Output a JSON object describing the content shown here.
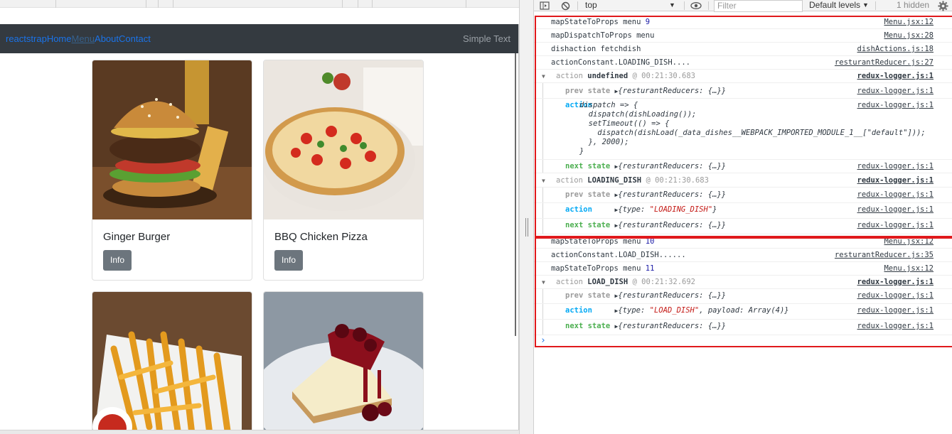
{
  "app": {
    "brand": "reactstrap",
    "nav_links": [
      "Home",
      "Menu",
      "About",
      "Contact"
    ],
    "active_link": "Menu",
    "nav_right_text": "Simple Text",
    "cards": [
      {
        "title": "Ginger Burger",
        "button": "Info",
        "image": "burger"
      },
      {
        "title": "BBQ Chicken Pizza",
        "button": "Info",
        "image": "pizza"
      },
      {
        "title": "",
        "button": "",
        "image": "fries"
      },
      {
        "title": "",
        "button": "",
        "image": "cheesecake"
      }
    ]
  },
  "devtools": {
    "toolbar": {
      "context": "top",
      "filter_placeholder": "Filter",
      "levels": "Default levels",
      "hidden": "1 hidden",
      "icons": [
        "sidebar-toggle-icon",
        "clear-console-icon",
        "eye-icon",
        "gear-icon"
      ]
    },
    "log": {
      "r1": {
        "text": "mapStateToProps menu ",
        "num": "9",
        "src": "Menu.jsx:12"
      },
      "r2": {
        "text": "mapDispatchToProps menu",
        "src": "Menu.jsx:28"
      },
      "r3": {
        "text": "dishaction fetchdish",
        "src": "dishActions.js:18"
      },
      "r4": {
        "text": "actionConstant.LOADING_DISH....",
        "src": "resturantReducer.js:27"
      },
      "g1": {
        "label": "action",
        "type": "undefined",
        "time": "@ 00:21:30.683",
        "src": "redux-logger.js:1"
      },
      "g1_prev": {
        "key": "prev state",
        "val": "{resturantReducers: {…}}",
        "src": "redux-logger.js:1"
      },
      "g1_action": {
        "key": "action",
        "code": "dispatch => {\n  dispatch(dishLoading());\n  setTimeout(() => {\n    dispatch(dishLoad(_data_dishes__WEBPACK_IMPORTED_MODULE_1__[\"default\"]));\n  }, 2000);\n}",
        "src": "redux-logger.js:1"
      },
      "g1_next": {
        "key": "next state",
        "val": "{resturantReducers: {…}}",
        "src": "redux-logger.js:1"
      },
      "g2": {
        "label": "action",
        "type": "LOADING_DISH",
        "time": "@ 00:21:30.683",
        "src": "redux-logger.js:1"
      },
      "g2_prev": {
        "key": "prev state",
        "val": "{resturantReducers: {…}}",
        "src": "redux-logger.js:1"
      },
      "g2_action": {
        "key": "action",
        "pre": "{type: ",
        "str": "\"LOADING_DISH\"",
        "post": "}",
        "src": "redux-logger.js:1"
      },
      "g2_next": {
        "key": "next state",
        "val": "{resturantReducers: {…}}",
        "src": "redux-logger.js:1"
      },
      "r5": {
        "text": "mapStateToProps menu ",
        "num": "10",
        "src": "Menu.jsx:12"
      },
      "r6": {
        "text": "actionConstant.LOAD_DISH......",
        "src": "resturantReducer.js:35"
      },
      "r7": {
        "text": "mapStateToProps menu ",
        "num": "11",
        "src": "Menu.jsx:12"
      },
      "g3": {
        "label": "action",
        "type": "LOAD_DISH",
        "time": "@ 00:21:32.692",
        "src": "redux-logger.js:1"
      },
      "g3_prev": {
        "key": "prev state",
        "val": "{resturantReducers: {…}}",
        "src": "redux-logger.js:1"
      },
      "g3_action": {
        "key": "action",
        "pre": "{type: ",
        "str": "\"LOAD_DISH\"",
        "mid": ", payload: ",
        "tail": "Array(4)}",
        "src": "redux-logger.js:1"
      },
      "g3_next": {
        "key": "next state",
        "val": "{resturantReducers: {…}}",
        "src": "redux-logger.js:1"
      },
      "prompt": "›"
    }
  },
  "colors": {
    "highlight_box": "#e0191c",
    "navbar_bg": "#343a40",
    "link": "#1a73e8",
    "action_key": "#03a9f4",
    "state_key": "#4caf50",
    "info_button": "#6c757d"
  }
}
